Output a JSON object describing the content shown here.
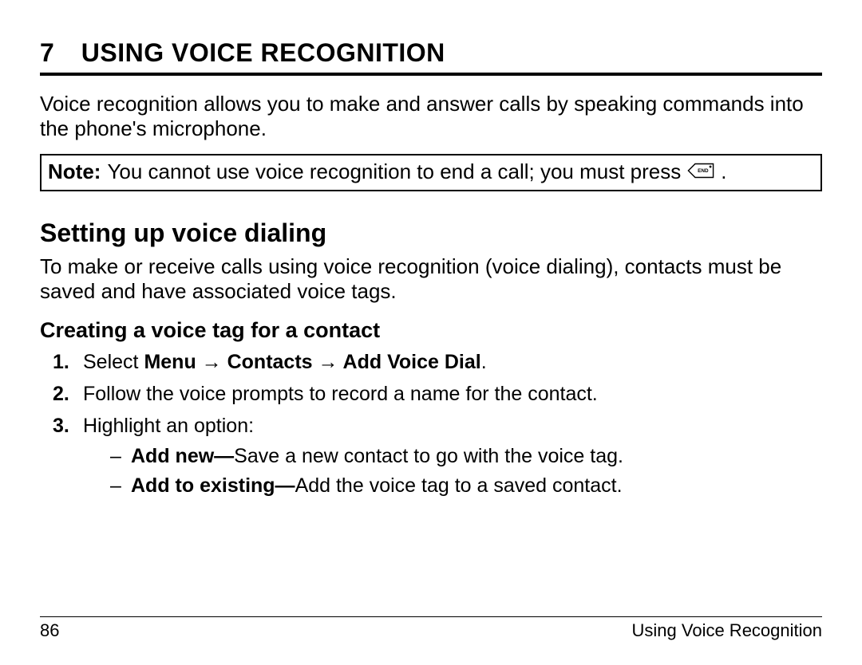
{
  "chapter": {
    "number": "7",
    "title": "USING VOICE RECOGNITION"
  },
  "intro": "Voice recognition allows you to make and answer calls by speaking commands into the phone's microphone.",
  "note": {
    "label": "Note:",
    "text_before": "You cannot use voice recognition to end a call; you must press",
    "icon_name": "end-key-icon",
    "text_after": "."
  },
  "section": {
    "title": "Setting up voice dialing",
    "para": "To make or receive calls using voice recognition (voice dialing), contacts must be saved and have associated voice tags."
  },
  "subsection": {
    "title": "Creating a voice tag for a contact",
    "steps": [
      {
        "num": "1.",
        "lead": "Select ",
        "bold": "Menu → Contacts → Add Voice Dial",
        "tail": "."
      },
      {
        "num": "2.",
        "lead": "Follow the voice prompts to record a name for the contact.",
        "bold": "",
        "tail": ""
      },
      {
        "num": "3.",
        "lead": "Highlight an option:",
        "bold": "",
        "tail": "",
        "sub": [
          {
            "bold": "Add new—",
            "tail_a": "Save",
            "tail_b": " a new contact to go with the voice tag."
          },
          {
            "bold": "Add to existing—",
            "tail_a": "Add the voice tag to a saved contact.",
            "tail_b": ""
          }
        ]
      }
    ]
  },
  "footer": {
    "page": "86",
    "section": "Using Voice Recognition"
  }
}
